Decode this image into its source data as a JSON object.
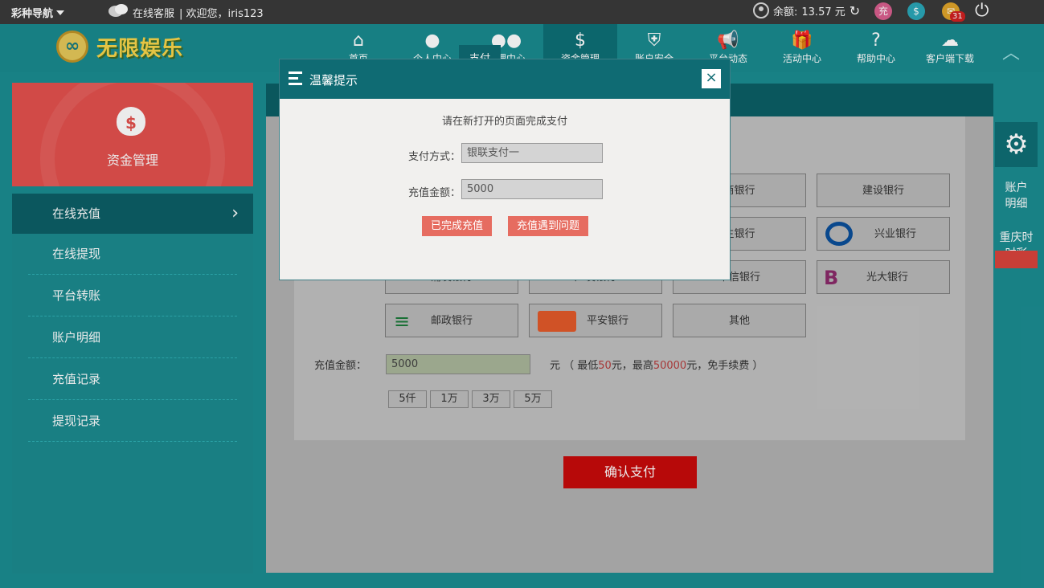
{
  "topbar": {
    "lottery_nav": "彩种导航",
    "customer_service": "在线客服",
    "welcome": "| 欢迎您，iris123",
    "balance_label": "余额:",
    "balance_value": "13.57 元",
    "recharge_icon_text": "充",
    "mail_count": "31"
  },
  "header": {
    "logo_text": "无限娱乐",
    "logo_mark": "∞",
    "nav": [
      {
        "label": "首页",
        "icon": "home-icon"
      },
      {
        "label": "个人中心",
        "icon": "user-icon"
      },
      {
        "label": "代理中心",
        "icon": "users-icon"
      },
      {
        "label": "资金管理",
        "icon": "money-bag-icon"
      },
      {
        "label": "账户安全",
        "icon": "shield-icon"
      },
      {
        "label": "平台动态",
        "icon": "megaphone-icon"
      },
      {
        "label": "活动中心",
        "icon": "gift-icon"
      },
      {
        "label": "帮助中心",
        "icon": "help-icon"
      },
      {
        "label": "客户端下载",
        "icon": "cloud-download-icon"
      }
    ]
  },
  "sidebar": {
    "header_label": "资金管理",
    "items": [
      {
        "label": "在线充值"
      },
      {
        "label": "在线提现"
      },
      {
        "label": "平台转账"
      },
      {
        "label": "账户明细"
      },
      {
        "label": "充值记录"
      },
      {
        "label": "提现记录"
      }
    ]
  },
  "main": {
    "active_tab_partial": "支付",
    "banks": [
      {
        "label": "商银行"
      },
      {
        "label": "建设银行"
      },
      {
        "label": "生银行"
      },
      {
        "label": "兴业银行"
      },
      {
        "label": "浦发银行"
      },
      {
        "label": "广发银行"
      },
      {
        "label": "中信银行"
      },
      {
        "label": "光大银行"
      },
      {
        "label": "邮政银行"
      },
      {
        "label": "平安银行"
      },
      {
        "label": "其他"
      }
    ],
    "amount_label": "充值金额：",
    "amount_value": "5000",
    "amount_note_pre": "元 （ 最低",
    "amount_min": "50",
    "amount_mid": "元，最高",
    "amount_max": "50000",
    "amount_note_post": "元，免手续费 ）",
    "quick": [
      "5仟",
      "1万",
      "3万",
      "5万"
    ],
    "confirm": "确认支付"
  },
  "right": {
    "account_detail": "账户明细",
    "chongqing": "重庆时时彩"
  },
  "modal": {
    "title": "温馨提示",
    "tip": "请在新打开的页面完成支付",
    "method_label": "支付方式：",
    "method_value": "银联支付一",
    "amount_label": "充值金额：",
    "amount_value": "5000",
    "done_button": "已完成充值",
    "problem_button": "充值遇到问题"
  }
}
